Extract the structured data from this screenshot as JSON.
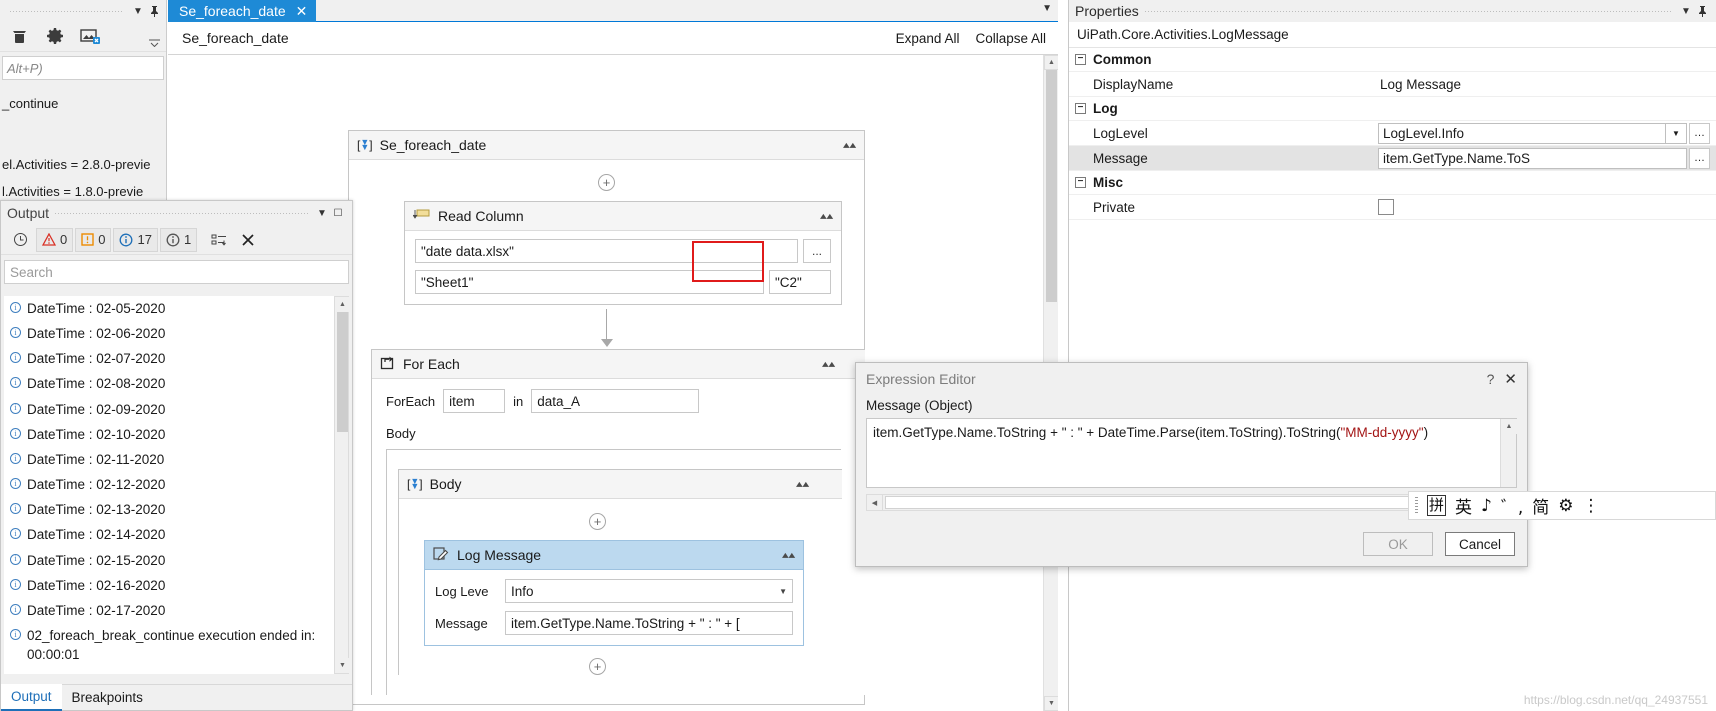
{
  "left_panel": {
    "search_placeholder": "Alt+P)",
    "tree": [
      {
        "label": "_continue"
      },
      {
        "label": "el.Activities = 2.8.0-previe"
      },
      {
        "label": "l.Activities = 1.8.0-previe"
      }
    ],
    "toolbar_icons": [
      "trash-icon",
      "gear-icon",
      "image-remove-icon"
    ]
  },
  "tabstrip": {
    "active_tab": "Se_foreach_date",
    "close_glyph": "✕",
    "dropdown_glyph": "▼"
  },
  "breadcrumb": {
    "path": "Se_foreach_date",
    "expand_all": "Expand All",
    "collapse_all": "Collapse All"
  },
  "designer": {
    "sequence": {
      "title": "Se_foreach_date",
      "read_column": {
        "title": "Read Column",
        "workbook": "\"date data.xlsx\"",
        "sheet": "\"Sheet1\"",
        "range": "\"C2\"",
        "browse_label": "...",
        "highlight_color": "#e01b1b"
      },
      "for_each": {
        "title": "For Each",
        "foreach_label": "ForEach",
        "item_var": "item",
        "in_label": "in",
        "collection": "data_A",
        "body_label": "Body",
        "body": {
          "title": "Body",
          "log_message": {
            "title": "Log Message",
            "loglevel_label": "Log Leve",
            "loglevel_value": "Info",
            "message_label": "Message",
            "message_value": "item.GetType.Name.ToString + \" : \" + ["
          }
        }
      }
    }
  },
  "output": {
    "title": "Output",
    "counters": [
      {
        "icon": "error-icon",
        "count": "0"
      },
      {
        "icon": "warning-icon",
        "count": "0"
      },
      {
        "icon": "info-icon",
        "count": "17"
      },
      {
        "icon": "trace-icon",
        "count": "1"
      }
    ],
    "clock_icon": "clock-icon",
    "filter_icon": "filter-icon",
    "clear_icon": "clear-icon",
    "search_placeholder": "Search",
    "entries": [
      "DateTime : 02-05-2020",
      "DateTime : 02-06-2020",
      "DateTime : 02-07-2020",
      "DateTime : 02-08-2020",
      "DateTime : 02-09-2020",
      "DateTime : 02-10-2020",
      "DateTime : 02-11-2020",
      "DateTime : 02-12-2020",
      "DateTime : 02-13-2020",
      "DateTime : 02-14-2020",
      "DateTime : 02-15-2020",
      "DateTime : 02-16-2020",
      "DateTime : 02-17-2020",
      "02_foreach_break_continue execution ended in: 00:00:01"
    ],
    "tabs": [
      {
        "label": "Output",
        "active": true
      },
      {
        "label": "Breakpoints",
        "active": false
      }
    ]
  },
  "properties": {
    "title": "Properties",
    "type_name": "UiPath.Core.Activities.LogMessage",
    "groups": [
      {
        "name": "Common",
        "rows": [
          {
            "name": "DisplayName",
            "value": "Log Message",
            "kind": "text"
          }
        ]
      },
      {
        "name": "Log",
        "rows": [
          {
            "name": "LogLevel",
            "value": "LogLevel.Info",
            "kind": "combo"
          },
          {
            "name": "Message",
            "value": "item.GetType.Name.ToS",
            "kind": "expression",
            "selected": true
          }
        ]
      },
      {
        "name": "Misc",
        "rows": [
          {
            "name": "Private",
            "value": "",
            "kind": "checkbox"
          }
        ]
      }
    ]
  },
  "expression_editor": {
    "title": "Expression Editor",
    "help_glyph": "?",
    "close_glyph": "✕",
    "field_label": "Message (Object)",
    "expression_plain": "item.GetType.Name.ToString + \" : \" + DateTime.Parse(item.ToString).ToString(",
    "expression_literal": "\"MM-dd-yyyy\"",
    "expression_tail": ")",
    "ok_label": "OK",
    "cancel_label": "Cancel"
  },
  "ime_bar": {
    "mode_icon": "拼",
    "language": "英",
    "shape_icon": "♪",
    "punct_icon": "゛,",
    "simplified": "简",
    "emoji_icon": "⚙",
    "menu_icon": "⋮"
  },
  "watermark": "https://blog.csdn.net/qq_24937551"
}
